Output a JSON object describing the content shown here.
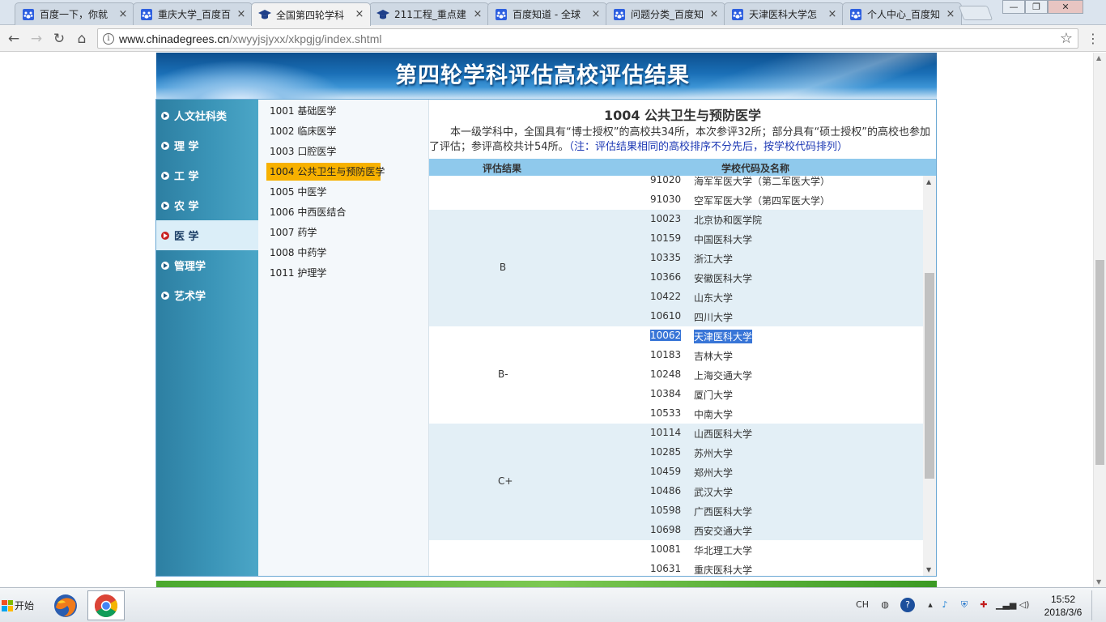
{
  "browser": {
    "tabs": [
      {
        "title": "百度一下，你就",
        "icon": "baidu-paw-icon",
        "active": false
      },
      {
        "title": "重庆大学_百度百",
        "icon": "baidu-paw-icon",
        "active": false
      },
      {
        "title": "全国第四轮学科",
        "icon": "graduation-cap-icon",
        "active": true
      },
      {
        "title": "211工程_重点建",
        "icon": "graduation-cap-icon",
        "active": false
      },
      {
        "title": "百度知道 - 全球",
        "icon": "baidu-paw-icon",
        "active": false
      },
      {
        "title": "问题分类_百度知",
        "icon": "baidu-paw-icon",
        "active": false
      },
      {
        "title": "天津医科大学怎",
        "icon": "baidu-paw-icon",
        "active": false
      },
      {
        "title": "个人中心_百度知",
        "icon": "baidu-paw-icon",
        "active": false
      }
    ],
    "url_host": "www.chinadegrees.cn",
    "url_path": "/xwyyjsjyxx/xkpgjg/index.shtml",
    "tab_close_glyph": "×",
    "window_buttons": [
      "—",
      "❐",
      "✕"
    ]
  },
  "banner": {
    "title": "第四轮学科评估高校评估结果"
  },
  "categories": [
    {
      "label": "人文社科类",
      "active": false
    },
    {
      "label": "理 学",
      "active": false
    },
    {
      "label": "工 学",
      "active": false
    },
    {
      "label": "农 学",
      "active": false
    },
    {
      "label": "医 学",
      "active": true
    },
    {
      "label": "管理学",
      "active": false
    },
    {
      "label": "艺术学",
      "active": false
    }
  ],
  "subjects": [
    {
      "label": "1001 基础医学",
      "active": false
    },
    {
      "label": "1002 临床医学",
      "active": false
    },
    {
      "label": "1003 口腔医学",
      "active": false
    },
    {
      "label": "1004 公共卫生与预防医学",
      "active": true
    },
    {
      "label": "1005 中医学",
      "active": false
    },
    {
      "label": "1006 中西医结合",
      "active": false
    },
    {
      "label": "1007 药学",
      "active": false
    },
    {
      "label": "1008 中药学",
      "active": false
    },
    {
      "label": "1011 护理学",
      "active": false
    }
  ],
  "content": {
    "title": "1004 公共卫生与预防医学",
    "intro": "本一级学科中，全国具有“博士授权”的高校共34所，本次参评32所；部分具有“硕士授权”的高校也参加了评估；参评高校共计54所。",
    "note": "（注：评估结果相同的高校排序不分先后，按学校代码排列）",
    "col_grade": "评估结果",
    "col_school": "学校代码及名称"
  },
  "results": [
    {
      "grade": "",
      "alt": false,
      "rows": [
        {
          "code": "91020",
          "name": "海军军医大学（第二军医大学）"
        },
        {
          "code": "91030",
          "name": "空军军医大学（第四军医大学）"
        }
      ]
    },
    {
      "grade": "B",
      "alt": true,
      "rows": [
        {
          "code": "10023",
          "name": "北京协和医学院"
        },
        {
          "code": "10159",
          "name": "中国医科大学"
        },
        {
          "code": "10335",
          "name": "浙江大学"
        },
        {
          "code": "10366",
          "name": "安徽医科大学"
        },
        {
          "code": "10422",
          "name": "山东大学"
        },
        {
          "code": "10610",
          "name": "四川大学"
        }
      ]
    },
    {
      "grade": "B-",
      "alt": false,
      "rows": [
        {
          "code": "10062",
          "name": "天津医科大学",
          "selected": true
        },
        {
          "code": "10183",
          "name": "吉林大学"
        },
        {
          "code": "10248",
          "name": "上海交通大学"
        },
        {
          "code": "10384",
          "name": "厦门大学"
        },
        {
          "code": "10533",
          "name": "中南大学"
        }
      ]
    },
    {
      "grade": "C+",
      "alt": true,
      "rows": [
        {
          "code": "10114",
          "name": "山西医科大学"
        },
        {
          "code": "10285",
          "name": "苏州大学"
        },
        {
          "code": "10459",
          "name": "郑州大学"
        },
        {
          "code": "10486",
          "name": "武汉大学"
        },
        {
          "code": "10598",
          "name": "广西医科大学"
        },
        {
          "code": "10698",
          "name": "西安交通大学"
        }
      ]
    },
    {
      "grade": "",
      "alt": false,
      "rows": [
        {
          "code": "10081",
          "name": "华北理工大学"
        },
        {
          "code": "10631",
          "name": "重庆医科大学"
        }
      ]
    }
  ],
  "taskbar": {
    "start_label": "开始",
    "apps": [
      {
        "name": "firefox-icon",
        "active": false
      },
      {
        "name": "chrome-icon",
        "active": true
      }
    ],
    "ime": "CH",
    "time": "15:52",
    "date": "2018/3/6"
  },
  "colors": {
    "accent_selected_subject": "#f7b100",
    "category_active_bullet": "#c81f1f",
    "table_header": "#8fc9ec",
    "row_alt": "#e3eff6",
    "selection": "#3875d7"
  }
}
